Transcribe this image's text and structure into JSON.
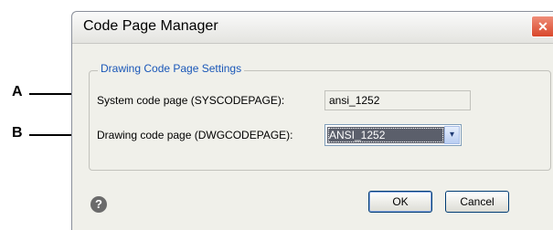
{
  "callouts": {
    "a": "A",
    "b": "B"
  },
  "window": {
    "title": "Code Page Manager",
    "close_glyph": "✕"
  },
  "group": {
    "label": "Drawing Code Page Settings",
    "system_label": "System code page (SYSCODEPAGE):",
    "system_value": "ansi_1252",
    "drawing_label": "Drawing code page (DWGCODEPAGE):",
    "drawing_value": "ANSI_1252",
    "dropdown_arrow": "▾"
  },
  "footer": {
    "help_glyph": "?",
    "ok_label": "OK",
    "cancel_label": "Cancel"
  },
  "colors": {
    "group_label": "#1a57b8",
    "close_button": "#d9472b",
    "selection": "#5b5f6b"
  }
}
